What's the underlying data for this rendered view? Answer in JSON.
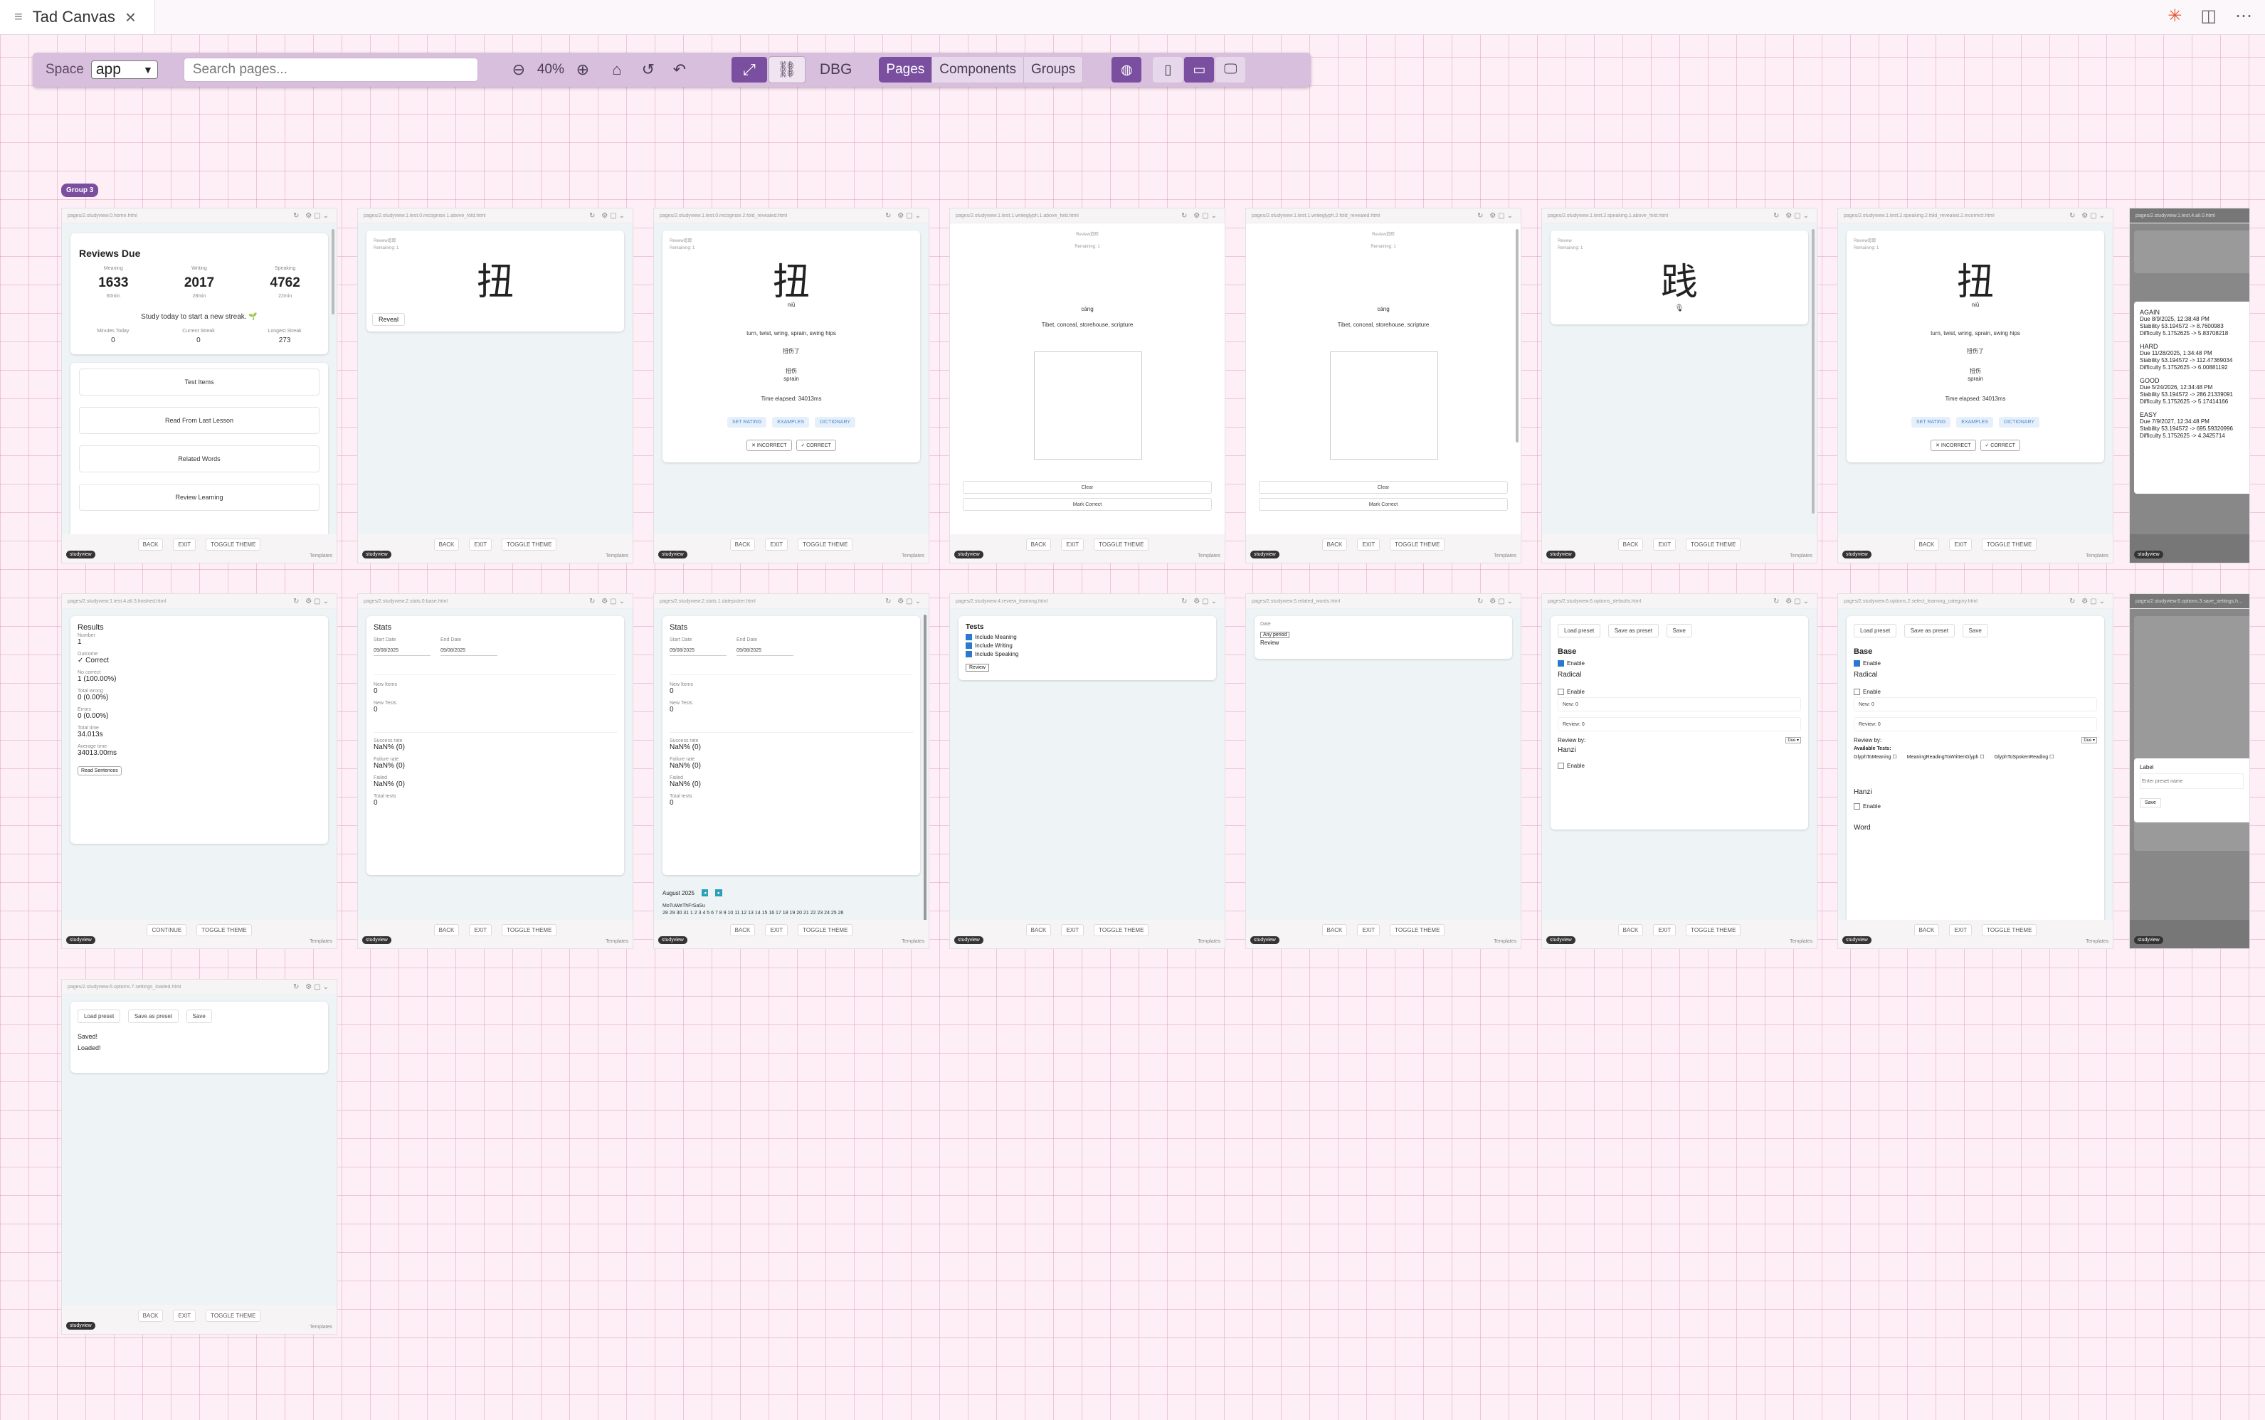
{
  "window": {
    "tab_title": "Tad Canvas"
  },
  "toolbar": {
    "space_label": "Space",
    "space_value": "app",
    "search_placeholder": "Search pages...",
    "zoom": "40%",
    "dbg": "DBG",
    "views": [
      "Pages",
      "Components",
      "Groups"
    ]
  },
  "group_badge": "Group 3",
  "frame_nav": {
    "back": "BACK",
    "exit": "EXIT",
    "toggle": "TOGGLE THEME",
    "continue": "CONTINUE",
    "badge": "studyview",
    "templates": "Templates"
  },
  "frames": {
    "home": {
      "path": "pages/2.studyview.0.home.html",
      "title": "Reviews Due",
      "stats": [
        {
          "label": "Meaning",
          "value": "1633",
          "sub": "60min"
        },
        {
          "label": "Writing",
          "value": "2017",
          "sub": "28min"
        },
        {
          "label": "Speaking",
          "value": "4762",
          "sub": "22min"
        }
      ],
      "streak": "Study today to start a new streak. 🌱",
      "stats2": [
        {
          "label": "Minutes Today",
          "value": "0"
        },
        {
          "label": "Current Streak",
          "value": "0"
        },
        {
          "label": "Longest Streak",
          "value": "273"
        }
      ],
      "buttons": [
        "Test Items",
        "Read From Last Lesson",
        "Related Words",
        "Review Learning"
      ]
    },
    "f2": {
      "path": "pages/2.studyview.1.test.0.recognise.1.above_fold.html",
      "meta1": "Review追踪",
      "meta2": "Remaining: 1",
      "glyph": "扭",
      "reveal": "Reveal"
    },
    "f3": {
      "path": "pages/2.studyview.1.test.0.recognise.2.fold_revealed.html",
      "meta1": "Review追踪",
      "meta2": "Remaining: 1",
      "glyph": "扭",
      "pinyin": "niǔ",
      "meaning": "turn, twist, wring, sprain, swing hips",
      "ex1": "扭伤了",
      "ex2": "扭伤",
      "ex3": "sprain",
      "time": "Time elapsed: 34013ms",
      "pills": [
        "SET RATING",
        "EXAMPLES",
        "DICTIONARY"
      ],
      "btns": [
        "✕ INCORRECT",
        "✓ CORRECT"
      ]
    },
    "f4": {
      "path": "pages/2.studyview.1.test.1.writeglyph.1.above_fold.html",
      "meta1": "Review追踪",
      "meta2": "Remaining: 1",
      "pinyin": "cáng",
      "meaning": "Tibet, conceal, storehouse, scripture",
      "clear": "Clear",
      "mark": "Mark Correct"
    },
    "f5": {
      "path": "pages/2.studyview.1.test.1.writeglyph.2.fold_revealed.html",
      "meta1": "Review追踪",
      "meta2": "Remaining: 1",
      "pinyin": "cáng",
      "meaning": "Tibet, conceal, storehouse, scripture",
      "clear": "Clear",
      "mark": "Mark Correct"
    },
    "f6": {
      "path": "pages/2.studyview.1.test.2.speaking.1.above_fold.html",
      "meta1": "Review",
      "meta2": "Remaining: 1",
      "glyph": "践",
      "mic": "🎙"
    },
    "f7": {
      "path": "pages/2.studyview.1.test.2.speaking.2.fold_revealed.2.incorrect.html",
      "meta1": "Review追踪",
      "meta2": "Remaining: 1",
      "glyph": "扭",
      "pinyin": "niǔ",
      "meaning": "turn, twist, wring, sprain, swing hips",
      "ex1": "扭伤了",
      "ex2": "扭伤",
      "ex3": "sprain",
      "time": "Time elapsed: 34013ms",
      "pills": [
        "SET RATING",
        "EXAMPLES",
        "DICTIONARY"
      ],
      "btns": [
        "✕ INCORRECT",
        "✓ CORRECT"
      ]
    },
    "f8": {
      "path": "pages/2.studyview.1.test.4.all.0.html",
      "srs": [
        {
          "rating": "AGAIN",
          "due": "Due 8/9/2025, 12:38:48 PM",
          "stab": "Stability 53.194572 -> 8.7600983",
          "diff": "Difficulty 5.1752625 -> 5.83708218"
        },
        {
          "rating": "HARD",
          "due": "Due 11/28/2025, 1:34:48 PM",
          "stab": "Stability 53.194572 -> 112.47369034",
          "diff": "Difficulty 5.1752625 -> 6.00881192"
        },
        {
          "rating": "GOOD",
          "due": "Due 5/24/2026, 12:34:48 PM",
          "stab": "Stability 53.194572 -> 286.21339091",
          "diff": "Difficulty 5.1752625 -> 5.17414166"
        },
        {
          "rating": "EASY",
          "due": "Due 7/9/2027, 12:34:48 PM",
          "stab": "Stability 53.194572 -> 695.59320996",
          "diff": "Difficulty 5.1752625 -> 4.3425714"
        }
      ]
    },
    "f9": {
      "path": "pages/2.studyview.1.test.4.all.3.finished.html",
      "title": "Results",
      "rows": [
        {
          "label": "Number",
          "value": "1"
        },
        {
          "label": "Outcome",
          "value": "✓ Correct"
        },
        {
          "label": "No correct",
          "value": "1 (100.00%)"
        },
        {
          "label": "Total wrong",
          "value": "0 (0.00%)"
        },
        {
          "label": "Errors",
          "value": "0 (0.00%)"
        },
        {
          "label": "Total time",
          "value": "34.013s"
        },
        {
          "label": "Average time",
          "value": "34013.00ms"
        }
      ],
      "btn": "Read Sentences"
    },
    "f10": {
      "path": "pages/2.studyview.2.stats.0.base.html",
      "title": "Stats",
      "start_label": "Start Date",
      "end_label": "End Date",
      "start": "09/08/2025",
      "end": "09/08/2025",
      "rows": [
        {
          "label": "New Items",
          "value": "0"
        },
        {
          "label": "New Tests",
          "value": "0"
        },
        {
          "label": "Success rate",
          "value": "NaN% (0)"
        },
        {
          "label": "Failure rate",
          "value": "NaN% (0)"
        },
        {
          "label": "Failed",
          "value": "NaN% (0)"
        },
        {
          "label": "Total tests",
          "value": "0"
        }
      ]
    },
    "f11": {
      "path": "pages/2.studyview.2.stats.1.datepicker.html",
      "title": "Stats",
      "start_label": "Start Date",
      "end_label": "End Date",
      "start": "09/08/2025",
      "end": "09/08/2025",
      "rows": [
        {
          "label": "New Items",
          "value": "0"
        },
        {
          "label": "New Tests",
          "value": "0"
        },
        {
          "label": "Success rate",
          "value": "NaN% (0)"
        },
        {
          "label": "Failure rate",
          "value": "NaN% (0)"
        },
        {
          "label": "Failed",
          "value": "NaN% (0)"
        },
        {
          "label": "Total tests",
          "value": "0"
        }
      ],
      "month": "August 2025",
      "weekdays": "MoTuWeThFrSaSu",
      "days": "28 29 30 31 1 2 3 4 5 6 7 8 9 10 11 12 13 14 15 16 17 18 19 20 21 22 23 24 25 26"
    },
    "f12": {
      "path": "pages/2.studyview.4.review_learning.html",
      "title": "Tests",
      "checks": [
        "Include Meaning",
        "Include Writing",
        "Include Speaking"
      ],
      "btn": "Review"
    },
    "f13": {
      "path": "pages/2.studyview.5.related_words.html",
      "small": "Date",
      "select": "Any period",
      "label": "Review"
    },
    "f14": {
      "path": "pages/2.studyview.6.options_defaults.html",
      "btns": [
        "Load preset",
        "Save as preset",
        "Save"
      ],
      "base": "Base",
      "enable": "Enable",
      "radical": "Radical",
      "new_label": "New:",
      "new_val": "0",
      "review_label": "Review:",
      "review_val": "0",
      "review_by": "Review by:",
      "due": "Due ▾",
      "hanzi": "Hanzi"
    },
    "f15": {
      "path": "pages/2.studyview.6.options.2.select_learning_category.html",
      "btns": [
        "Load preset",
        "Save as preset",
        "Save"
      ],
      "base": "Base",
      "enable": "Enable",
      "radical": "Radical",
      "new_label": "New:",
      "new_val": "0",
      "review_label": "Review:",
      "review_val": "0",
      "review_by": "Review by:",
      "due": "Due ▾",
      "avail": "Available Tests:",
      "tests": [
        "GlyphToMeaning",
        "MeaningReadingToWrittenGlyph",
        "GlyphToSpokenReading"
      ],
      "hanzi": "Hanzi",
      "word": "Word"
    },
    "f16": {
      "path": "pages/2.studyview.6.options.3.save_settings.html",
      "label": "Label",
      "placeholder": "Enter preset name",
      "save": "Save"
    },
    "f17": {
      "path": "pages/2.studyview.6.options.7.settings_loaded.html",
      "btns": [
        "Load preset",
        "Save as preset",
        "Save"
      ],
      "saved": "Saved!",
      "loaded": "Loaded!"
    }
  }
}
